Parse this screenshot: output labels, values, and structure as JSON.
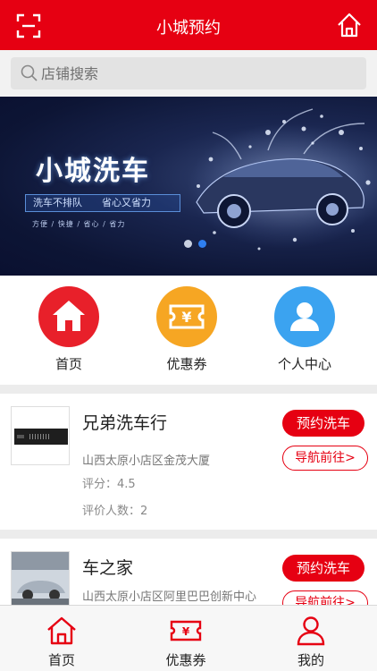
{
  "header": {
    "title": "小城预约",
    "scan_icon": "scan-icon",
    "home_icon": "home-icon"
  },
  "search": {
    "placeholder": "店铺搜索"
  },
  "banner": {
    "title": "小城洗车",
    "tag1": "洗车不排队",
    "tag2": "省心又省力",
    "subtags": "方便   /   快捷   /   省心   /   省力",
    "active_dot": 2,
    "dot_count": 3
  },
  "quick_nav": [
    {
      "label": "首页",
      "icon": "home-icon",
      "color": "#e8202a"
    },
    {
      "label": "优惠券",
      "icon": "coupon-icon",
      "color": "#f6a623"
    },
    {
      "label": "个人中心",
      "icon": "person-icon",
      "color": "#3ba3f0"
    }
  ],
  "shops": [
    {
      "name": "兄弟洗车行",
      "address": "山西太原小店区金茂大厦",
      "rating": "评分：4.5",
      "reviews": "评价人数：2",
      "book_label": "预约洗车",
      "nav_label": "导航前往>"
    },
    {
      "name": "车之家",
      "address": "山西太原小店区阿里巴巴创新中心",
      "book_label": "预约洗车",
      "nav_label": "导航前往>"
    }
  ],
  "tabbar": [
    {
      "label": "首页",
      "icon": "home-icon"
    },
    {
      "label": "优惠券",
      "icon": "coupon-icon"
    },
    {
      "label": "我的",
      "icon": "person-icon"
    }
  ],
  "colors": {
    "brand_red": "#e60012",
    "active_dot": "#2f7ff0"
  }
}
